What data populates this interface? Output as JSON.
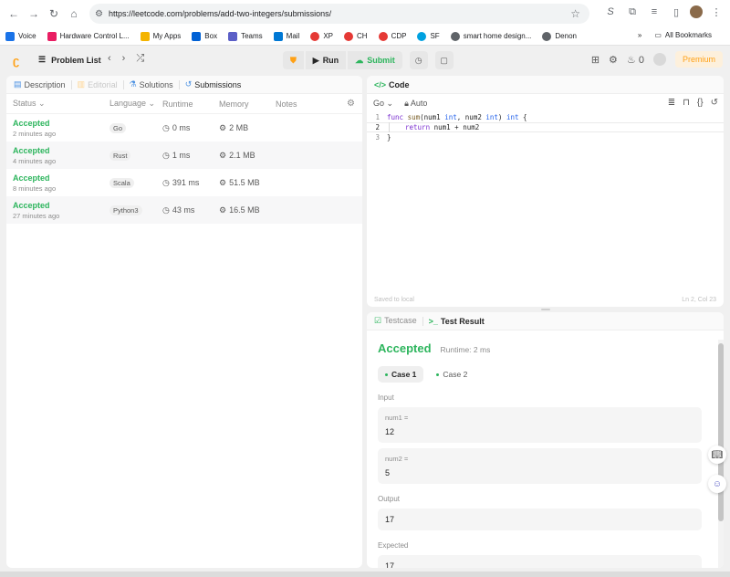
{
  "browser": {
    "url": "https://leetcode.com/problems/add-two-integers/submissions/",
    "bookmarks": [
      "Voice",
      "Hardware Control L...",
      "My Apps",
      "Box",
      "Teams",
      "Mail",
      "XP",
      "CH",
      "CDP",
      "SF",
      "smart home design...",
      "Denon"
    ],
    "all_bookmarks": "All Bookmarks"
  },
  "header": {
    "problem_list": "Problem List",
    "run": "Run",
    "submit": "Submit",
    "streak": "0",
    "premium": "Premium"
  },
  "left": {
    "tabs": [
      "Description",
      "Editorial",
      "Solutions",
      "Submissions"
    ],
    "columns": [
      "Status",
      "Language",
      "Runtime",
      "Memory",
      "Notes"
    ],
    "rows": [
      {
        "status": "Accepted",
        "ago": "2 minutes ago",
        "lang": "Go",
        "runtime": "0 ms",
        "memory": "2 MB"
      },
      {
        "status": "Accepted",
        "ago": "4 minutes ago",
        "lang": "Rust",
        "runtime": "1 ms",
        "memory": "2.1 MB"
      },
      {
        "status": "Accepted",
        "ago": "8 minutes ago",
        "lang": "Scala",
        "runtime": "391 ms",
        "memory": "51.5 MB"
      },
      {
        "status": "Accepted",
        "ago": "27 minutes ago",
        "lang": "Python3",
        "runtime": "43 ms",
        "memory": "16.5 MB"
      }
    ]
  },
  "code": {
    "title": "Code",
    "lang": "Go",
    "auto": "Auto",
    "lines": [
      "1",
      "2",
      "3"
    ],
    "tokens": {
      "func": "func",
      "sum": "sum",
      "open": "(num1 ",
      "int1": "int",
      "mid": ", num2 ",
      "int2": "int",
      "close": ") ",
      "int3": "int",
      "brace": " {",
      "ret": "return",
      "expr": " num1 + num2",
      "end": "}"
    },
    "saved": "Saved to local",
    "position": "Ln 2, Col 23"
  },
  "result": {
    "tab_testcase": "Testcase",
    "tab_result": "Test Result",
    "status": "Accepted",
    "runtime": "Runtime: 2 ms",
    "cases": [
      "Case 1",
      "Case 2"
    ],
    "input_label": "Input",
    "num1_name": "num1 =",
    "num1_val": "12",
    "num2_name": "num2 =",
    "num2_val": "5",
    "output_label": "Output",
    "output_val": "17",
    "expected_label": "Expected",
    "expected_val": "17"
  },
  "colors": {
    "accent": "#ffa116",
    "success": "#2db55d"
  }
}
